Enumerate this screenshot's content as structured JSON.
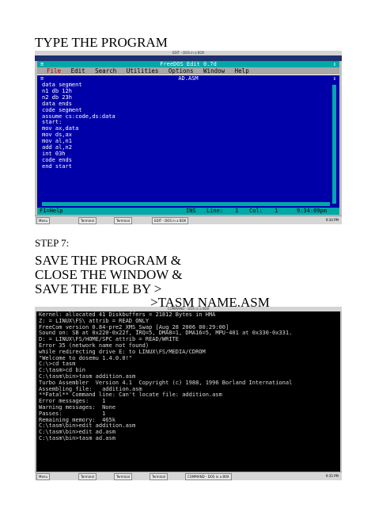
{
  "heading1": "TYPE THE PROGRAM",
  "step_label": "STEP 7:",
  "instructions": [
    "SAVE THE PROGRAM &",
    "CLOSE THE WINDOW &",
    "SAVE THE FILE BY >",
    ">TASM NAME.ASM"
  ],
  "editor": {
    "window_title": "EDIT - DOS in a BOX",
    "app_title": "FreeDOS Edit 0.7d",
    "menu": [
      "File",
      "Edit",
      "Search",
      "Utilities",
      "Options",
      "Window",
      "Help"
    ],
    "file_title": "AD.ASM",
    "code_lines": [
      "data segment",
      "n1 db 12h",
      "n2 db 23h",
      "data ends",
      "code segment",
      "assume cs:code,ds:data",
      "start:",
      "mov ax,data",
      "mov ds,ax",
      "mov al,n1",
      "add al,n2",
      "int 03h",
      "code ends",
      "end start"
    ],
    "status": {
      "help": "F1=Help",
      "mode": "INS",
      "line_label": "Line:",
      "line": "1",
      "col_label": "Col:",
      "col": "1",
      "clock": "9:34:09pm"
    },
    "taskbar": {
      "menu": "Menu",
      "items": [
        "Terminal",
        "Terminal",
        "EDIT - DOS in a BOX"
      ],
      "time": "9:34 PM"
    }
  },
  "terminal": {
    "window_title": "COMMAND - DOS in a BOX",
    "lines": [
      "Kernel: allocated 41 Diskbuffers = 21812 Bytes in HMA",
      "Z: = LINUX\\FS\\ attrib = READ ONLY",
      "",
      "FreeCom version 0.84-pre2 XMS_Swap [Aug 28 2006 00:29:00]",
      "Sound on: SB at 0x220-0x22f, IRQ=5, DMA8=1, DMA16=5, MPU-401 at 0x330-0x331.",
      "D: = LINUX\\FS/HOME/SPC attrib = READ/WRITE",
      "Error 35 (network name not found)",
      "while redirecting drive E: to LINUX\\FS/MEDIA/CDROM",
      "\"Welcome to dosemu 1.4.0.0!\"",
      "C:\\>cd tasm",
      "C:\\tasm>cd bin",
      "C:\\tasm\\bin>tasm addition.asm",
      "Turbo Assembler  Version 4.1  Copyright (c) 1988, 1996 Borland International",
      "",
      "Assembling file:   addition.asm",
      "**Fatal** Command line: Can't locate file: addition.asm",
      "Error messages:    1",
      "Warning messages:  None",
      "Passes:            1",
      "Remaining memory:  465k",
      "",
      "C:\\tasm\\bin>edit addition.asm",
      "C:\\tasm\\bin>edit ad.asm",
      "C:\\tasm\\bin>tasm ad.asm"
    ],
    "taskbar": {
      "menu": "Menu",
      "items": [
        "Terminal",
        "Terminal",
        "Terminal",
        "COMMAND - DOS in a BOX"
      ],
      "time": "9:35 PM"
    }
  },
  "colors": {
    "dos_blue": "#0000a8",
    "dos_cyan": "#00a8a8",
    "dos_gray": "#a8a8a8",
    "terminal_bg": "#000000"
  }
}
